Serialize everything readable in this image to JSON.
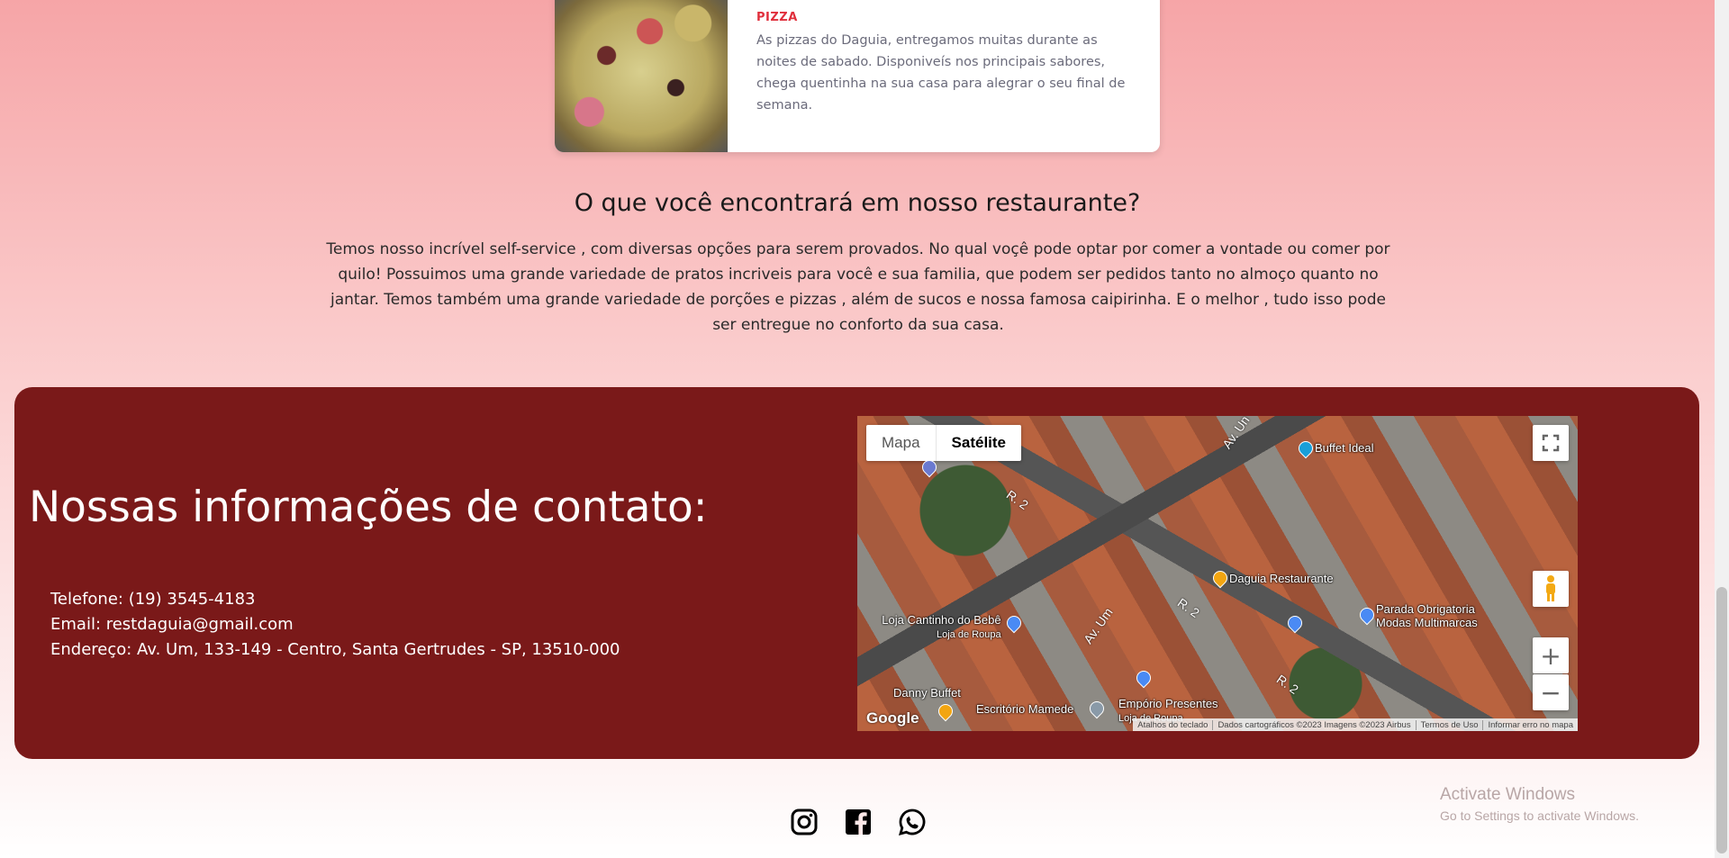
{
  "card": {
    "category": "PIZZA",
    "description": "As pizzas do Daguia, entregamos muitas durante as noites de sabado. Disponiveís nos principais sabores, chega quentinha na sua casa para alegrar o seu final de semana."
  },
  "section": {
    "title": "O que você encontrará em nosso restaurante?",
    "body": "Temos nosso incrível self-service , com diversas opções para serem provados. No qual voçê pode optar por comer a vontade ou comer por quilo! Possuimos uma grande variedade de pratos incriveis para você e sua familia, que podem ser pedidos tanto no almoço quanto no jantar. Temos também uma grande variedade de porções e pizzas , além de sucos e nossa famosa caipirinha. E o melhor , tudo isso pode ser entregue no conforto da sua casa."
  },
  "contact": {
    "title": "Nossas informações de contato:",
    "phone": "Telefone: (19) 3545-4183",
    "email": "Email: restdaguia@gmail.com",
    "address": "Endereço: Av. Um, 133-149 - Centro, Santa Gertrudes - SP, 13510-000"
  },
  "map": {
    "tab_map": "Mapa",
    "tab_satellite": "Satélite",
    "labels": {
      "buffet_ideal": "Buffet Ideal",
      "daguia": "Daguia Restaurante",
      "parada_1": "Parada Obrigatoria",
      "parada_2": "Modas Multimarcas",
      "loja_bebe": "Loja Cantinho do Bebê",
      "loja_bebe_sub": "Loja de Roupa",
      "danny": "Danny Buffet",
      "escritorio": "Escritório Mamede",
      "emporio": "Empório Presentes",
      "emporio_sub": "Loja de Roupa",
      "street_r2a": "R. 2",
      "street_r2b": "R. 2",
      "street_r2c": "R. 2",
      "street_avum": "Av. Um",
      "street_avum2": "Av. Un"
    },
    "google": "Google",
    "attribution": {
      "keyboard": "Atalhos do teclado",
      "data": "Dados cartográficos ©2023 Imagens ©2023 Airbus",
      "terms": "Termos de Uso",
      "report": "Informar erro no mapa"
    }
  },
  "social": [
    "instagram-icon",
    "facebook-icon",
    "whatsapp-icon"
  ],
  "watermark": {
    "line1": "Activate Windows",
    "line2": "Go to Settings to activate Windows."
  },
  "colors": {
    "accent": "#e02f3c",
    "footer_bg": "#7a1919"
  }
}
